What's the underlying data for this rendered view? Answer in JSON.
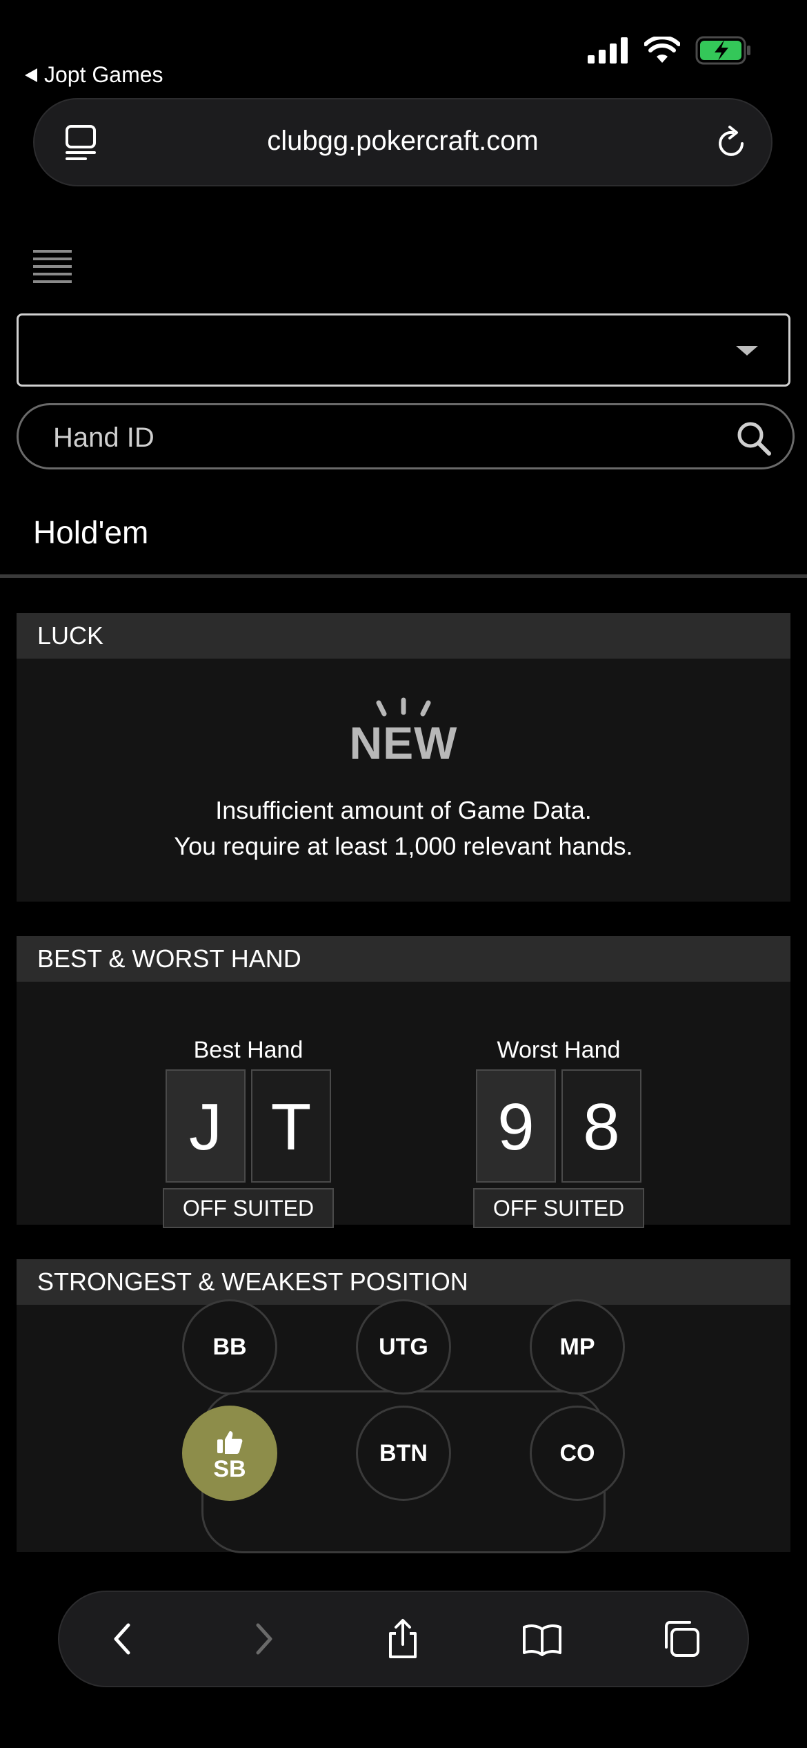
{
  "status_bar": {
    "back_app_label": "Jopt Games",
    "icons": [
      "signal-icon",
      "wifi-icon",
      "battery-charging-icon"
    ]
  },
  "browser": {
    "url": "clubgg.pokercraft.com"
  },
  "search": {
    "placeholder": "Hand ID"
  },
  "game_type": "Hold'em",
  "luck": {
    "title": "LUCK",
    "badge": "NEW",
    "message_line1": "Insufficient amount of Game Data.",
    "message_line2": "You require at least 1,000 relevant hands."
  },
  "best_worst": {
    "title": "BEST & WORST HAND",
    "best": {
      "label": "Best Hand",
      "card1": "J",
      "card2": "T",
      "type": "OFF SUITED"
    },
    "worst": {
      "label": "Worst Hand",
      "card1": "9",
      "card2": "8",
      "type": "OFF SUITED"
    }
  },
  "positions": {
    "title": "STRONGEST & WEAKEST POSITION",
    "seats": {
      "bb": "BB",
      "utg": "UTG",
      "mp": "MP",
      "sb": "SB",
      "btn": "BTN",
      "co": "CO"
    },
    "strongest": "SB",
    "accent_color": "#8d8d4a"
  },
  "toolbar_icons": [
    "back-icon",
    "forward-icon",
    "share-icon",
    "bookmarks-icon",
    "tabs-icon"
  ]
}
